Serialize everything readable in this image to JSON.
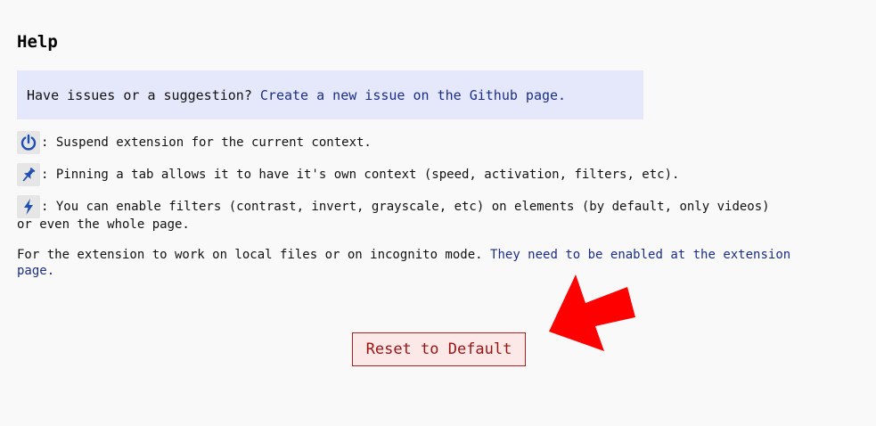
{
  "help": {
    "title": "Help",
    "issue_prefix": "Have issues or a suggestion?",
    "issue_link": "Create a new issue on the Github page.",
    "power_text": ": Suspend extension for the current context.",
    "pin_text": ": Pinning a tab allows it to have it's own context (speed, activation, filters, etc).",
    "bolt_text_line1": ": You can enable filters (contrast, invert, grayscale, etc) on elements (by default, only videos)",
    "bolt_text_line2": "or even the whole page.",
    "local_prefix": "For the extension to work on local files or on incognito mode.",
    "local_link": "They need to be enabled at the extension page."
  },
  "reset_button": {
    "label": "Reset to Default"
  },
  "icons": {
    "power": "power-icon",
    "pin": "pin-icon",
    "bolt": "lightning-icon",
    "arrow": "red-arrow-annotation"
  },
  "colors": {
    "link": "#1b2e86",
    "icon": "#1f4fb4",
    "issue_box_bg": "#e5e8fb",
    "reset_border": "#b11f1f",
    "reset_bg": "#fde8e8",
    "arrow": "#ff0000"
  }
}
